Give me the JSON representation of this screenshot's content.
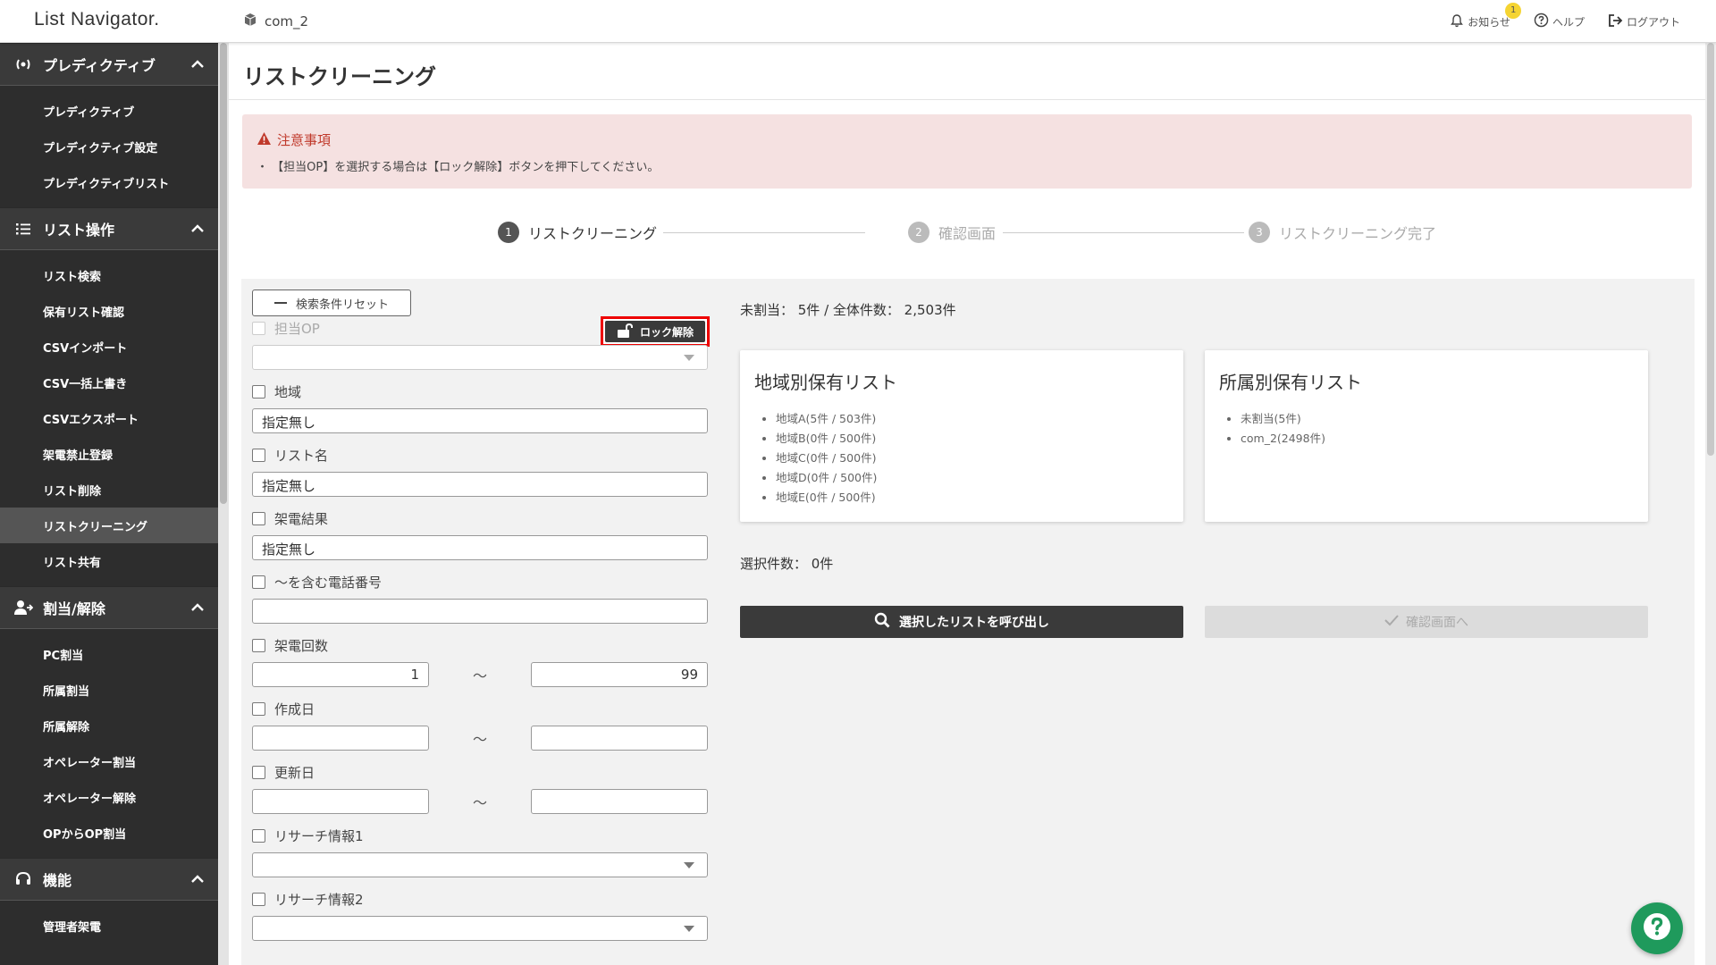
{
  "header": {
    "logo": "List Navigator.",
    "tenant": "com_2",
    "notifications_label": "お知らせ",
    "notifications_count": "1",
    "help_label": "ヘルプ",
    "logout_label": "ログアウト"
  },
  "sidebar": {
    "sections": [
      {
        "title": "プレディクティブ",
        "icon": "broadcast-icon",
        "items": [
          "プレディクティブ",
          "プレディクティブ設定",
          "プレディクティブリスト"
        ]
      },
      {
        "title": "リスト操作",
        "icon": "list-icon",
        "items": [
          "リスト検索",
          "保有リスト確認",
          "CSVインポート",
          "CSV一括上書き",
          "CSVエクスポート",
          "架電禁止登録",
          "リスト削除",
          "リストクリーニング",
          "リスト共有"
        ]
      },
      {
        "title": "割当/解除",
        "icon": "user-assign-icon",
        "items": [
          "PC割当",
          "所属割当",
          "所属解除",
          "オペレーター割当",
          "オペレーター解除",
          "OPからOP割当"
        ]
      },
      {
        "title": "機能",
        "icon": "headset-icon",
        "items": [
          "管理者架電"
        ]
      }
    ],
    "active_item": "リストクリーニング"
  },
  "page": {
    "title": "リストクリーニング",
    "notice_title": "注意事項",
    "notice_text": "・ 【担当OP】を選択する場合は【ロック解除】ボタンを押下してください。"
  },
  "stepper": {
    "steps": [
      {
        "num": "1",
        "label": "リストクリーニング",
        "state": "active"
      },
      {
        "num": "2",
        "label": "確認画面",
        "state": "inactive"
      },
      {
        "num": "3",
        "label": "リストクリーニング完了",
        "state": "inactive"
      }
    ]
  },
  "filters": {
    "reset_label": "検索条件リセット",
    "lock_label": "ロック解除",
    "assignee_op": {
      "label": "担当OP",
      "value": ""
    },
    "region": {
      "label": "地域",
      "value": "指定無し"
    },
    "list_name": {
      "label": "リスト名",
      "value": "指定無し"
    },
    "call_result": {
      "label": "架電結果",
      "value": "指定無し"
    },
    "phone_contains": {
      "label": "〜を含む電話番号",
      "value": ""
    },
    "call_count": {
      "label": "架電回数",
      "from": "1",
      "to": "99",
      "sep": "〜"
    },
    "created_date": {
      "label": "作成日",
      "from": "",
      "to": "",
      "sep": "〜"
    },
    "updated_date": {
      "label": "更新日",
      "from": "",
      "to": "",
      "sep": "〜"
    },
    "research1": {
      "label": "リサーチ情報1",
      "value": ""
    },
    "research2": {
      "label": "リサーチ情報2",
      "value": ""
    }
  },
  "summary": {
    "count_text": "未割当： 5件 / 全体件数： 2,503件",
    "selected_text": "選択件数： 0件"
  },
  "region_card": {
    "title": "地域別保有リスト",
    "items": [
      "地域A(5件 / 503件)",
      "地域B(0件 / 500件)",
      "地域C(0件 / 500件)",
      "地域D(0件 / 500件)",
      "地域E(0件 / 500件)"
    ]
  },
  "dept_card": {
    "title": "所属別保有リスト",
    "items": [
      "未割当(5件)",
      "com_2(2498件)"
    ]
  },
  "actions": {
    "call_label": "選択したリストを呼び出し",
    "confirm_label": "確認画面へ"
  }
}
